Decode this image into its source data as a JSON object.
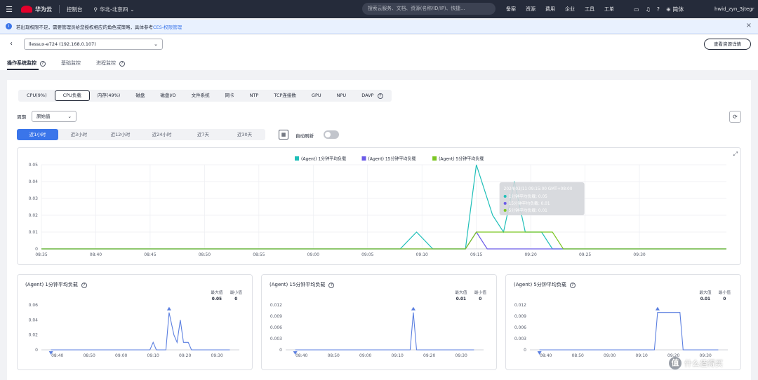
{
  "topnav": {
    "brand": "华为云",
    "console": "控制台",
    "region": "华北-北京四",
    "search_placeholder": "搜索云服务、文档、资源(名称/ID/IP)、快捷...",
    "links": [
      "备案",
      "资源",
      "费用",
      "企业",
      "工具",
      "工单"
    ],
    "language": "简体",
    "username": "hwid_zyn_3jtegr"
  },
  "infobar": {
    "text": "若出现权限不足，需要管理员给您授权相应的角色或策略，具体参考",
    "link": "CES-权限管理"
  },
  "host": {
    "selected": "llessux-e724 (192.168.0.107)",
    "view_button": "查看资源详情"
  },
  "subtabs": [
    {
      "label": "操作系统监控",
      "active": true,
      "help": true
    },
    {
      "label": "基础监控",
      "active": false,
      "help": false
    },
    {
      "label": "进程监控",
      "active": false,
      "help": true
    }
  ],
  "metric_tabs": [
    "CPU(9%)",
    "CPU负载",
    "内存(49%)",
    "磁盘",
    "磁盘I/O",
    "文件系统",
    "网卡",
    "NTP",
    "TCP连接数",
    "GPU",
    "NPU",
    "DAVP"
  ],
  "metric_active": "CPU负载",
  "period": {
    "label": "周期",
    "value": "原始值"
  },
  "ranges": [
    "近1小时",
    "近3小时",
    "近12小时",
    "近24小时",
    "近7天",
    "近30天"
  ],
  "range_active": "近1小时",
  "auto_refresh_label": "自动刷新",
  "chart_data": [
    {
      "type": "line",
      "title": "",
      "x": [
        "08:35",
        "08:40",
        "08:45",
        "08:50",
        "08:55",
        "09:00",
        "09:05",
        "09:10",
        "09:15",
        "09:20",
        "09:25",
        "09:30"
      ],
      "ylim": [
        0,
        0.05
      ],
      "yticks": [
        "0",
        "0.01",
        "0.02",
        "0.03",
        "0.04",
        "0.05"
      ],
      "legend": "top-center",
      "colors": [
        "#1fbfb8",
        "#6b5be8",
        "#7cc623"
      ],
      "series": [
        {
          "name": "(Agent) 1分钟平均负载",
          "points": [
            [
              "08:35",
              0
            ],
            [
              "09:08",
              0
            ],
            [
              "09:09.5",
              0.01
            ],
            [
              "09:11",
              0
            ],
            [
              "09:14",
              0
            ],
            [
              "09:15",
              0.05
            ],
            [
              "09:16.5",
              0.02
            ],
            [
              "09:17.5",
              0.01
            ],
            [
              "09:18.5",
              0.04
            ],
            [
              "09:19.5",
              0.01
            ],
            [
              "09:21",
              0.01
            ],
            [
              "09:22",
              0
            ],
            [
              "09:38",
              0
            ]
          ]
        },
        {
          "name": "(Agent) 15分钟平均负载",
          "points": [
            [
              "08:35",
              0
            ],
            [
              "09:14",
              0
            ],
            [
              "09:15",
              0.01
            ],
            [
              "09:16",
              0
            ],
            [
              "09:38",
              0
            ]
          ]
        },
        {
          "name": "(Agent) 5分钟平均负载",
          "points": [
            [
              "08:35",
              0
            ],
            [
              "09:14",
              0
            ],
            [
              "09:15",
              0.01
            ],
            [
              "09:22",
              0.01
            ],
            [
              "09:23",
              0
            ],
            [
              "09:38",
              0
            ]
          ]
        }
      ],
      "tooltip": {
        "time": "2024/03/11 09:15:00 GMT+08:00",
        "lines": [
          "1分钟平均负载: 0.05",
          "15分钟平均负载: 0.01",
          "5分钟平均负载: 0.01"
        ]
      }
    },
    {
      "type": "line",
      "title": "(Agent) 1分钟平均负载",
      "max": "0.05",
      "min": "0",
      "x": [
        "08:40",
        "08:50",
        "09:00",
        "09:10",
        "09:20",
        "09:30"
      ],
      "ylim": [
        0,
        0.06
      ],
      "yticks": [
        "0",
        "0.02",
        "0.04",
        "0.06"
      ],
      "series": [
        {
          "name": "",
          "points": [
            [
              "08:38",
              0
            ],
            [
              "09:09",
              0
            ],
            [
              "09:10",
              0.01
            ],
            [
              "09:11",
              0
            ],
            [
              "09:14",
              0
            ],
            [
              "09:15",
              0.05
            ],
            [
              "09:16.5",
              0.02
            ],
            [
              "09:17.5",
              0.01
            ],
            [
              "09:18.5",
              0.04
            ],
            [
              "09:19.5",
              0.01
            ],
            [
              "09:21",
              0.01
            ],
            [
              "09:22",
              0
            ],
            [
              "09:34",
              0
            ]
          ]
        }
      ]
    },
    {
      "type": "line",
      "title": "(Agent) 15分钟平均负载",
      "max": "0.01",
      "min": "0",
      "x": [
        "08:40",
        "08:50",
        "09:00",
        "09:10",
        "09:20",
        "09:30"
      ],
      "ylim": [
        0,
        0.012
      ],
      "yticks": [
        "0",
        "0.003",
        "0.006",
        "0.009",
        "0.012"
      ],
      "series": [
        {
          "name": "",
          "points": [
            [
              "08:38",
              0
            ],
            [
              "09:14",
              0
            ],
            [
              "09:15",
              0.01
            ],
            [
              "09:16",
              0
            ],
            [
              "09:34",
              0
            ]
          ]
        }
      ]
    },
    {
      "type": "line",
      "title": "(Agent) 5分钟平均负载",
      "max": "0.01",
      "min": "0",
      "x": [
        "08:40",
        "08:50",
        "09:00",
        "09:10",
        "09:20",
        "09:30"
      ],
      "ylim": [
        0,
        0.012
      ],
      "yticks": [
        "0",
        "0.003",
        "0.006",
        "0.009",
        "0.012"
      ],
      "series": [
        {
          "name": "",
          "points": [
            [
              "08:38",
              0
            ],
            [
              "09:14",
              0
            ],
            [
              "09:15",
              0.01
            ],
            [
              "09:22",
              0.01
            ],
            [
              "09:23",
              0
            ],
            [
              "09:34",
              0
            ]
          ]
        }
      ]
    }
  ],
  "card_labels": {
    "max": "最大值",
    "min": "最小值"
  },
  "watermark": "什么值得买"
}
